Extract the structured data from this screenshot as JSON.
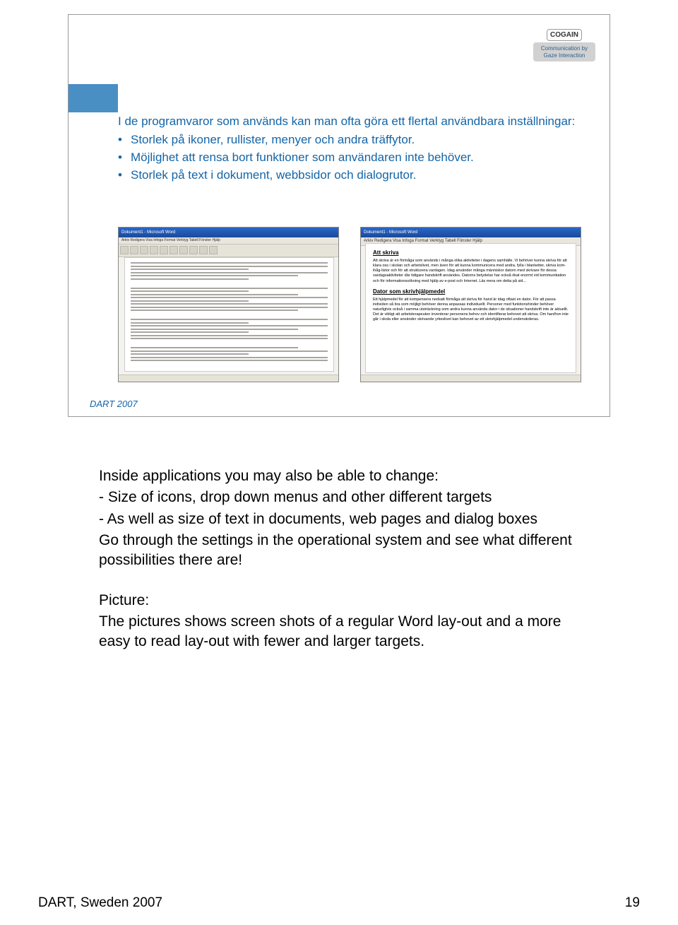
{
  "logo": {
    "brand": "COGAIN",
    "tagline": "Communication by Gaze Interaction"
  },
  "slide": {
    "intro": "I de programvaror som används kan man ofta göra ett flertal användbara inställningar:",
    "bullets": [
      "Storlek på ikoner, rullister, menyer och andra träffytor.",
      "Möjlighet att rensa bort funktioner som användaren inte behöver.",
      "Storlek på text i dokument, webbsidor och dialogrutor."
    ],
    "footer": "DART 2007",
    "shot_left": {
      "title": "Dokument1 - Microsoft Word",
      "menu": "Arkiv  Redigera  Visa  Infoga  Format  Verktyg  Tabell  Fönster  Hjälp"
    },
    "shot_right": {
      "title": "Dokument1 - Microsoft Word",
      "menu": "Arkiv  Redigera  Visa  Infoga  Format  Verktyg  Tabell  Fönster  Hjälp",
      "heading1": "Att skriva",
      "para1": "Att skriva är en förmåga som används i många olika aktiviteter i dagens samhälle. Vi behöver kunna skriva för att klara oss i skolan och arbetslivet, men även för att kunna kommunicera med andra, fylla i blanketter, skriva kom-ihåg-listor och för att strukturera vardagen. Idag använder många människor datorn med skrivare för dessa vardagsaktiviteter där tidigare handskrift användes. Datorns betydelse har också ökat enormt vid kommunikation och för informationssökning med hjälp av e-post och Internet. Läs mera om detta på sid...",
      "heading2": "Dator som skrivhjälpmedel",
      "para2": "Ett hjälpmedel för att kompensera nedsatt förmåga att skriva för hand är idag oftast en dator. För att passa individen så bra som möjligt behöver denna anpassas individuellt. Personer med funktionshinder behöver naturligtvis också i samma utsträckning som andra kunna använda dator i de situationer handskrift inte är aktuellt. Det är viktigt att arbetsterapeuten inventerar personens behov och identifierar behovet att skriva. Om han/hon inte går i skola eller använder skrivande yrkeslivet kan behovet av ett skrivhjälpmedel undervärderas."
    }
  },
  "body": {
    "line1": "Inside applications you may also be able to  change:",
    "line2": "- Size of icons, drop down menus and other different targets",
    "line3": "- As well as size of text in documents, web pages and dialog boxes",
    "line4": "Go through the settings in the operational system and see what different possibilities there are!",
    "pic_head": "Picture:",
    "pic_desc": "The pictures shows screen shots of a regular Word lay-out and a more easy to read lay-out with fewer and larger targets."
  },
  "footer": {
    "left": "DART, Sweden 2007",
    "right": "19"
  }
}
